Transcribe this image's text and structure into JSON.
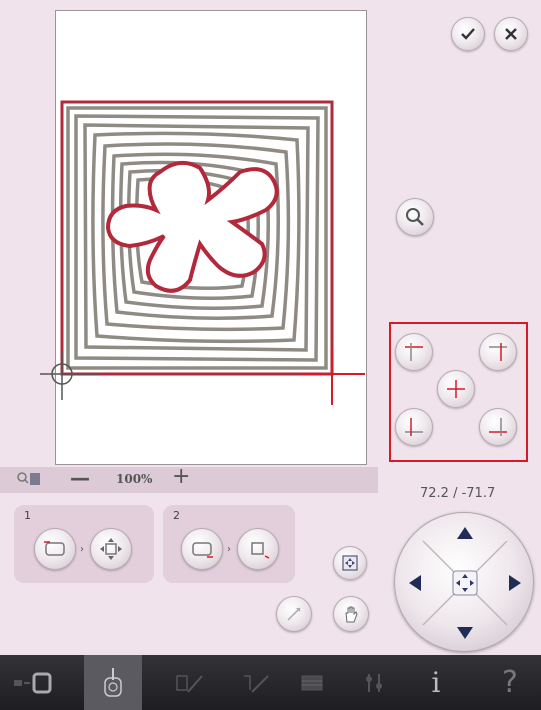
{
  "toolbar": {
    "confirm_icon": "checkmark-icon",
    "cancel_icon": "close-icon"
  },
  "zoom": {
    "minus_label": "—",
    "percent": "100%",
    "plus_label": "+"
  },
  "position": {
    "coordinates": "72.2 / -71.7"
  },
  "groups": [
    {
      "number": "1"
    },
    {
      "number": "2"
    }
  ],
  "colors": {
    "accent_red": "#d81a28",
    "stitch_gray": "#8f8b84",
    "stitch_red": "#b3283a"
  },
  "taskbar": {
    "items": [
      "file-manager-icon",
      "embroidery-stitch-out-icon",
      "embroidery-edit-icon",
      "sewing-mode-icon",
      "tablet-icon",
      "settings-icon",
      "info-icon",
      "help-icon"
    ],
    "help_label": "?",
    "info_label": "i"
  }
}
